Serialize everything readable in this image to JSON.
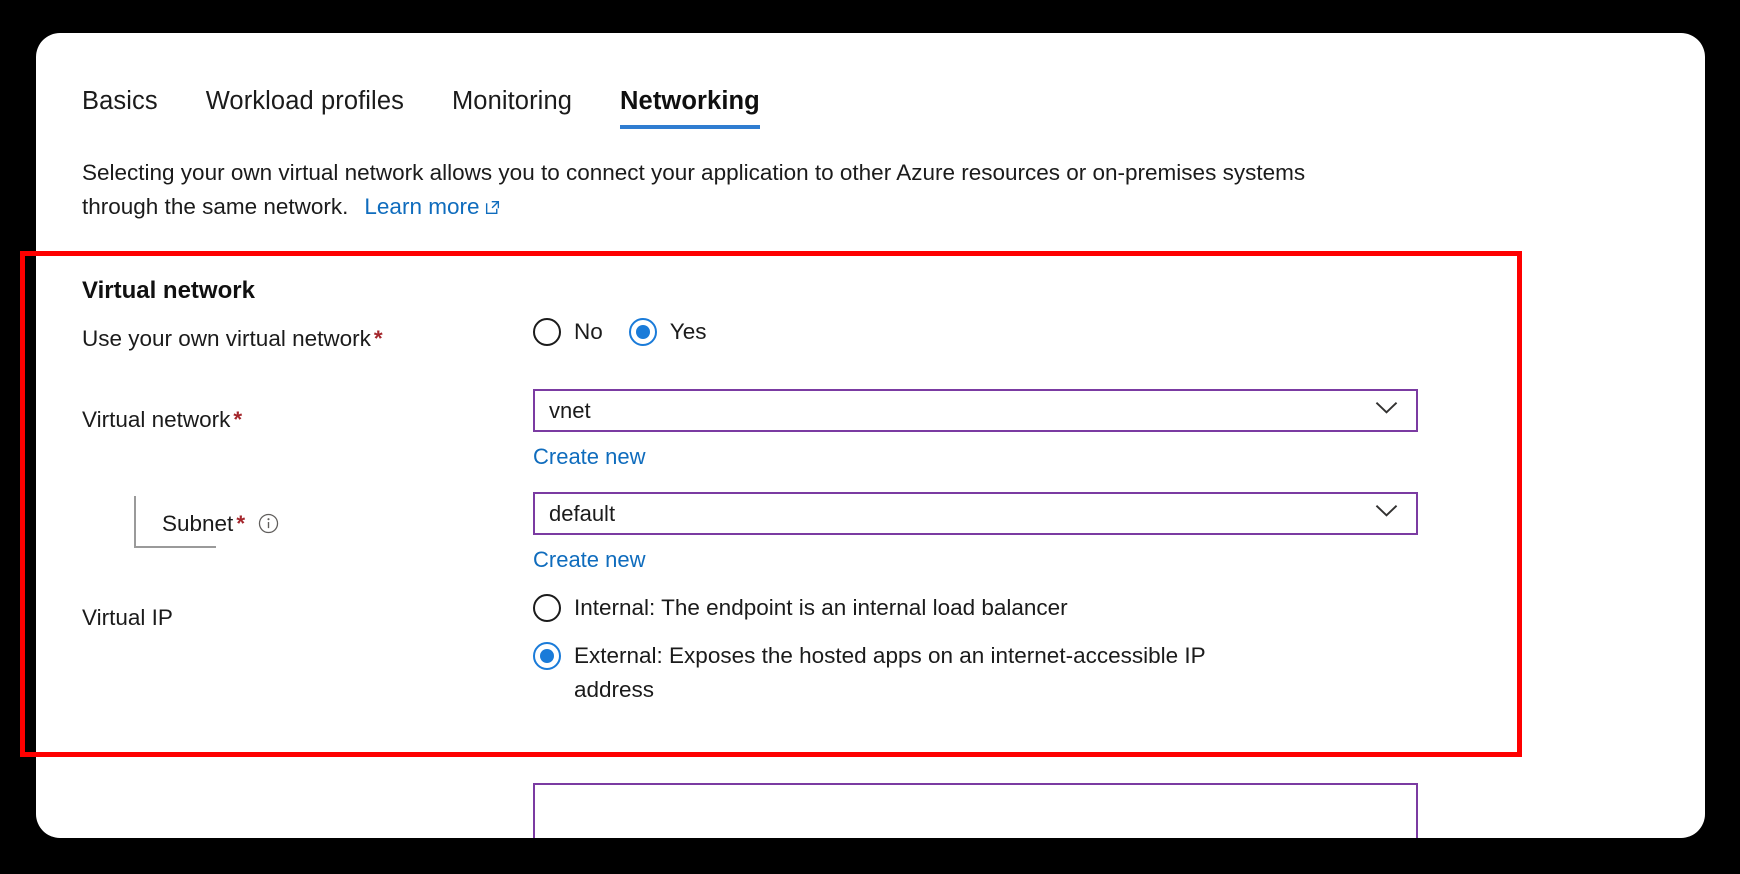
{
  "window": {
    "card_background": "#ffffff",
    "page_background": "#000000"
  },
  "tabs": [
    {
      "label": "Basics",
      "active": false
    },
    {
      "label": "Workload profiles",
      "active": false
    },
    {
      "label": "Monitoring",
      "active": false
    },
    {
      "label": "Networking",
      "active": true
    }
  ],
  "intro": {
    "line1": "Selecting your own virtual network allows you to connect your application to other Azure resources or on-premises",
    "line2": "systems through the same network.",
    "learn_more": "Learn more",
    "learn_more_icon": "external-link-icon"
  },
  "section": {
    "title": "Virtual network"
  },
  "fields": {
    "use_own_vnet": {
      "label": "Use your own virtual network",
      "required": "*",
      "options": [
        {
          "label": "No",
          "selected": false
        },
        {
          "label": "Yes",
          "selected": true
        }
      ]
    },
    "virtual_network": {
      "label": "Virtual network",
      "required": "*",
      "value": "vnet",
      "create_new": "Create new",
      "chevron": "chevron-down-icon"
    },
    "subnet": {
      "label": "Subnet",
      "required": "*",
      "info_icon": "info-icon",
      "value": "default",
      "create_new": "Create new",
      "chevron": "chevron-down-icon"
    },
    "virtual_ip": {
      "label": "Virtual IP",
      "options": [
        {
          "label": "Internal: The endpoint is an internal load balancer",
          "selected": false
        },
        {
          "label": "External: Exposes the hosted apps on an internet-accessible IP address",
          "selected": true
        }
      ]
    }
  },
  "colors": {
    "accent_blue": "#0f6cbd",
    "tab_underline": "#2f7dd1",
    "radio_selected": "#1a7bd9",
    "input_border": "#7b3ba2",
    "required_asterisk": "#a4262c",
    "annotation_red": "#fe0000"
  }
}
